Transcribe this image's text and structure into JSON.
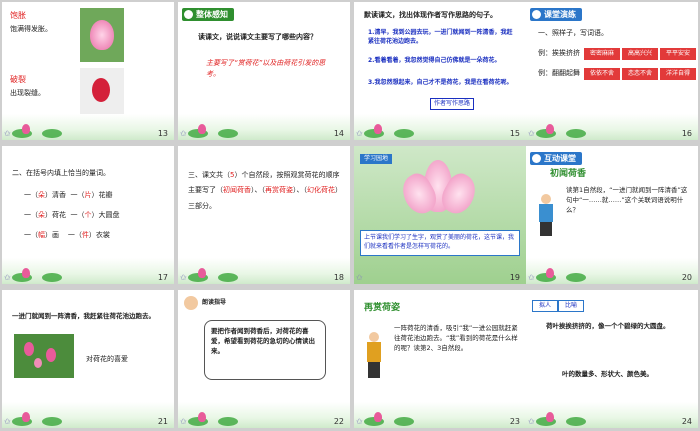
{
  "slides": [
    {
      "num": "13",
      "lines": [
        "饱胀",
        "饱满得发胀。",
        "破裂",
        "出现裂缝。"
      ]
    },
    {
      "num": "14",
      "header": "整体感知",
      "question": "读课文，说说课文主要写了哪些内容？",
      "answer": "主要写了“赏荷花”以及由荷花引发的思考。"
    },
    {
      "num": "15",
      "question": "默读课文，找出体现作者写作思路的句子。",
      "items": [
        "1.清早，我到公园去玩，一进门就闻到一阵清香，我赶紧往荷花池边跑去。",
        "2.看着看着，我忽然觉得自己仿佛就是一朵荷花。",
        "3.我忽然想起来，自己才不是荷花，我是在看荷花呢。"
      ],
      "tag": "作者写作思路"
    },
    {
      "num": "16",
      "header": "课堂演练",
      "q": "一、照样子，写词语。",
      "ex1": "例：挨挨挤挤",
      "ex2": "例：翻翻起舞",
      "boxes": [
        "密密麻麻",
        "高高兴兴",
        "平平安安",
        "依依不舍",
        "恋恋不舍",
        "洋洋自得"
      ]
    },
    {
      "num": "17",
      "q": "二、在括号内填上恰当的量词。",
      "rows": [
        [
          "一（",
          "朵",
          "）清香",
          "一（",
          "片",
          "）花瓣"
        ],
        [
          "一（",
          "朵",
          "）荷花",
          "一（",
          "个",
          "）大圆盘"
        ],
        [
          "一（",
          "幅",
          "）画",
          "一（",
          "件",
          "）衣裳"
        ]
      ]
    },
    {
      "num": "18",
      "text1": "三、课文共（",
      "n": "5",
      "text2": "）个自然段，按照观赏荷花的顺序主要写了（",
      "a1": "初闻荷香",
      "a2": "再赏荷姿",
      "a3": "幻化荷花",
      "text3": "）三部分。"
    },
    {
      "num": "19",
      "tag": "学习园地",
      "caption": "上节课我们学习了生字，观赏了美丽的荷花，这节课，我们就来看看作者是怎样写荷花的。"
    },
    {
      "num": "20",
      "header": "互动课堂",
      "sub": "初闻荷香",
      "body": "读第1自然段，“一进门就闻到一阵清香”这句中“一……就……”这个关联词语说明什么？"
    },
    {
      "num": "21",
      "line": "一进门就闻到一阵清香，我赶紧往荷花池边跑去。",
      "label": "对荷花的喜爱"
    },
    {
      "num": "22",
      "tag": "朗读指导",
      "body": "要把作者闻到荷香后，对荷花的喜爱，希望看到荷花的急切的心情读出来。"
    },
    {
      "num": "23",
      "title": "再赏荷姿",
      "body": "一阵荷花的清香，吸引“我”一进公园就赶紧往荷花池边跑去。“我”看到的荷花是什么样的呢？读第2、3自然段。"
    },
    {
      "num": "24",
      "tags": [
        "拟人",
        "比喻"
      ],
      "body1": "荷叶挨挨挤挤的，像一个个碧绿的大圆盘。",
      "body2": "叶的数量多、形状大、颜色美。"
    }
  ],
  "colors": {
    "header_green": "#2f8f2f",
    "header_blue": "#2b76c9",
    "red": "#e02020",
    "blue": "#1a2fc0"
  }
}
